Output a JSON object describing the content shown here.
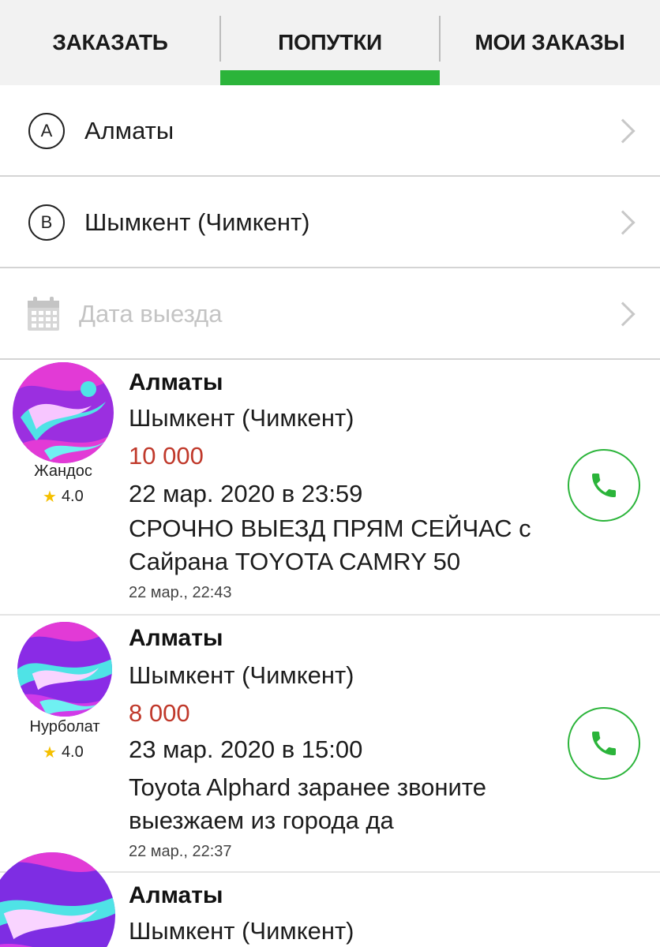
{
  "tabs": [
    {
      "label": "ЗАКАЗАТЬ"
    },
    {
      "label": "ПОПУТКИ"
    },
    {
      "label": "МОИ ЗАКАЗЫ"
    }
  ],
  "accent_color": "#2bb43a",
  "price_color": "#c0392b",
  "route": {
    "from": {
      "badge": "A",
      "value": "Алматы"
    },
    "to": {
      "badge": "B",
      "value": "Шымкент (Чимкент)"
    },
    "date": {
      "placeholder": "Дата выезда"
    }
  },
  "listings": [
    {
      "user": "Жандос",
      "rating": "4.0",
      "from": "Алматы",
      "to": "Шымкент (Чимкент)",
      "price": "10 000",
      "departure": "22 мар. 2020 в 23:59",
      "description": "СРОЧНО ВЫЕЗД ПРЯМ СЕЙЧАС с Сайрана TOYOTA CAMRY 50",
      "posted": "22 мар., 22:43"
    },
    {
      "user": "Нурболат",
      "rating": "4.0",
      "from": "Алматы",
      "to": "Шымкент (Чимкент)",
      "price": "8 000",
      "departure": "23 мар. 2020 в 15:00",
      "description": "Toyota Alphard заранее звоните выезжаем из города да",
      "posted": "22 мар., 22:37"
    },
    {
      "from": "Алматы",
      "to": "Шымкент (Чимкент)"
    }
  ],
  "icons": {
    "calendar": "calendar-icon",
    "chevron": "chevron-right-icon",
    "phone": "phone-icon",
    "star": "star-icon"
  }
}
